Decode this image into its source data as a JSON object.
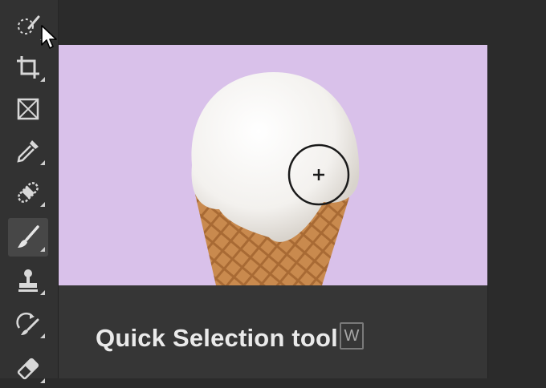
{
  "tooltip": {
    "title": "Quick Selection tool",
    "shortcut": "W"
  },
  "toolbar": {
    "tools": [
      {
        "name": "quick-selection",
        "icon": "quick-selection-icon",
        "active": false,
        "hovered": true
      },
      {
        "name": "crop",
        "icon": "crop-icon",
        "active": false
      },
      {
        "name": "frame",
        "icon": "frame-icon",
        "active": false
      },
      {
        "name": "eyedropper",
        "icon": "eyedropper-icon",
        "active": false
      },
      {
        "name": "spot-healing",
        "icon": "bandage-icon",
        "active": false
      },
      {
        "name": "brush",
        "icon": "brush-icon",
        "active": true
      },
      {
        "name": "clone-stamp",
        "icon": "stamp-icon",
        "active": false
      },
      {
        "name": "history-brush",
        "icon": "history-brush-icon",
        "active": false
      },
      {
        "name": "eraser",
        "icon": "eraser-icon",
        "active": false
      }
    ]
  },
  "colors": {
    "preview_background": "#d9c1ea",
    "panel": "#363636",
    "toolbar": "#323232",
    "workspace": "#2b2b2b",
    "caption_text": "#eaeaea"
  }
}
